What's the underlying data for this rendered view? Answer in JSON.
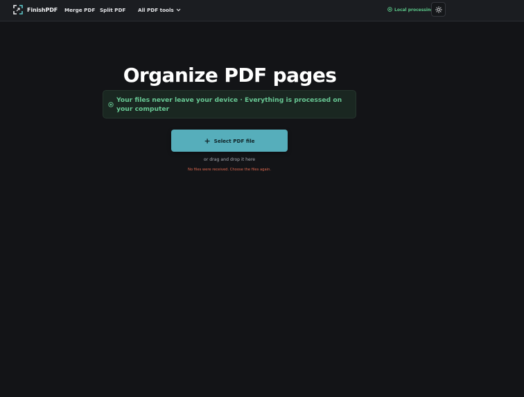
{
  "brand": {
    "name": "FinishPDF",
    "logo_icon": "crop-frame-icon"
  },
  "nav": {
    "merge": "Merge PDF",
    "split": "Split PDF",
    "tools": "All PDF tools"
  },
  "status": {
    "local": "Local processing",
    "icon": "shield-check-icon"
  },
  "theme_toggle": {
    "icon": "sun-icon"
  },
  "main": {
    "title": "Organize PDF pages",
    "privacy_note": "Your files never leave your device · Everything is processed on your computer",
    "select_button": "Select PDF file",
    "drag_hint": "or drag and drop it here",
    "error": "No files were received. Choose the files again."
  },
  "colors": {
    "background": "#131417",
    "navbar": "#1b1d21",
    "accent": "#56aebb",
    "success": "#5cc98a",
    "error": "#e0694f"
  }
}
